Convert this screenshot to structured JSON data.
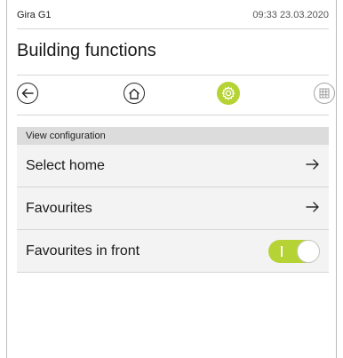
{
  "status_bar": {
    "device_name": "Gira G1",
    "datetime": "09:33 23.03.2020"
  },
  "page": {
    "title": "Building functions"
  },
  "nav": {
    "buttons": [
      {
        "icon": "back-arrow-icon"
      },
      {
        "icon": "home-icon"
      },
      {
        "icon": "gear-icon",
        "active": true
      },
      {
        "icon": "grid-icon"
      }
    ],
    "accent_color": "#b5d334"
  },
  "section": {
    "header": "View configuration"
  },
  "items": [
    {
      "label": "Select home",
      "control": "arrow-right-icon"
    },
    {
      "label": "Favourites",
      "control": "arrow-right-icon"
    },
    {
      "label": "Favourites in front",
      "control": "toggle",
      "toggle_on": true
    }
  ]
}
